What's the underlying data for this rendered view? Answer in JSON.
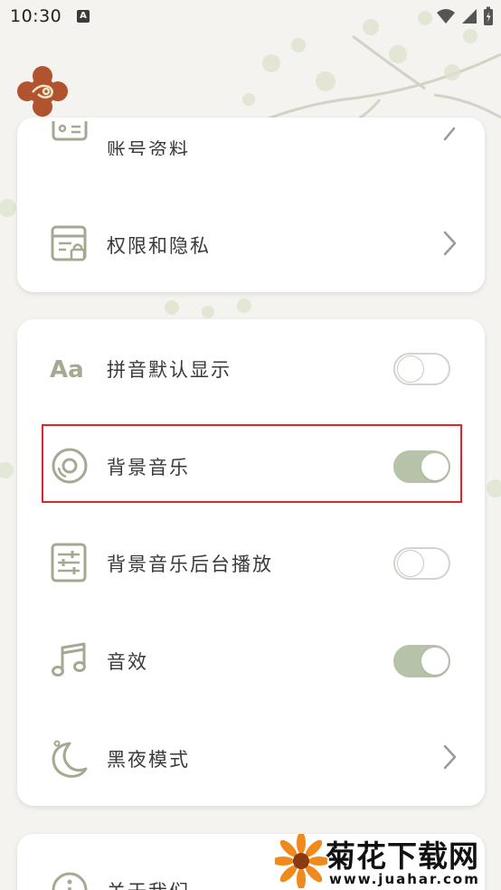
{
  "status_bar": {
    "time": "10:30",
    "notification_icon": "A",
    "icons": [
      "wifi-icon",
      "signal-icon",
      "battery-icon"
    ]
  },
  "app": {
    "logo_icon": "flower-logo-icon"
  },
  "card_account": {
    "items": [
      {
        "label": "账号资料",
        "icon": "id-card-icon",
        "control": "chevron"
      },
      {
        "label": "权限和隐私",
        "icon": "privacy-lock-icon",
        "control": "chevron"
      }
    ]
  },
  "card_settings": {
    "items": [
      {
        "label": "拼音默认显示",
        "icon": "font-aa-icon",
        "control": "toggle",
        "on": false
      },
      {
        "label": "背景音乐",
        "icon": "disc-icon",
        "control": "toggle",
        "on": true
      },
      {
        "label": "背景音乐后台播放",
        "icon": "sliders-icon",
        "control": "toggle",
        "on": false
      },
      {
        "label": "音效",
        "icon": "music-note-icon",
        "control": "toggle",
        "on": true
      },
      {
        "label": "黑夜模式",
        "icon": "moon-icon",
        "control": "chevron"
      }
    ]
  },
  "card_about": {
    "items": [
      {
        "label": "关于我们",
        "icon": "info-icon"
      }
    ]
  },
  "watermark": {
    "title": "菊花下载网",
    "url": "www.juahar.com"
  },
  "colors": {
    "icon_olive": "#a7a892",
    "toggle_on": "#b7c3a9",
    "highlight": "#e0262b",
    "background": "#f4f3ef"
  }
}
